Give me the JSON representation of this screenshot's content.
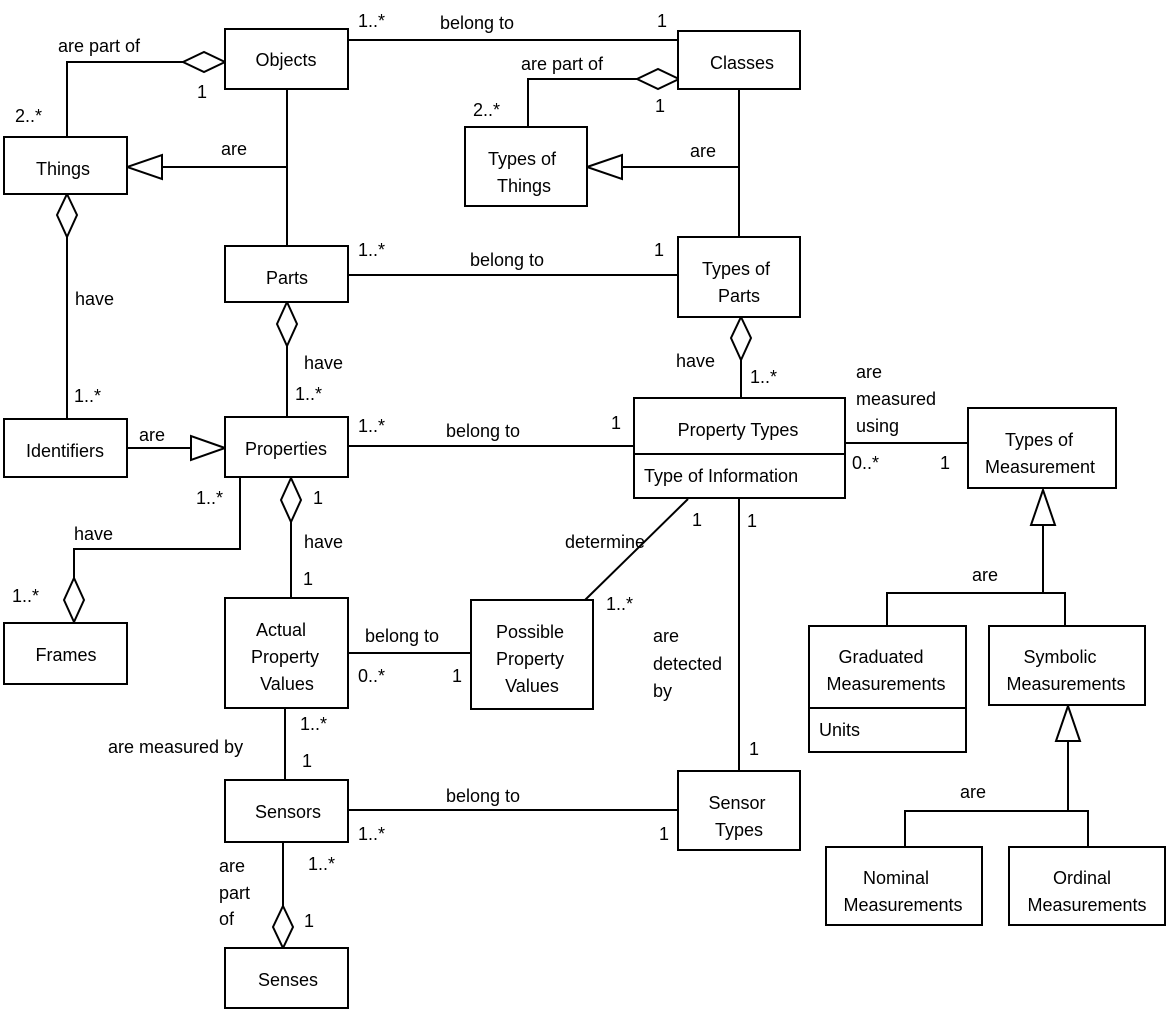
{
  "classes": {
    "objects": [
      "Objects"
    ],
    "classes": [
      "Classes"
    ],
    "things": [
      "Things"
    ],
    "types_of_things": [
      "Types of",
      "Things"
    ],
    "parts": [
      "Parts"
    ],
    "types_of_parts": [
      "Types of",
      "Parts"
    ],
    "identifiers": [
      "Identifiers"
    ],
    "properties": [
      "Properties"
    ],
    "property_types": {
      "name": "Property Types",
      "attribute": "Type of Information"
    },
    "types_of_measurement": [
      "Types of",
      "Measurement"
    ],
    "frames": [
      "Frames"
    ],
    "actual_property_values": [
      "Actual",
      "Property",
      "Values"
    ],
    "possible_property_values": [
      "Possible",
      "Property",
      "Values"
    ],
    "graduated_measurements": {
      "name": [
        "Graduated",
        "Measurements"
      ],
      "attribute": "Units"
    },
    "symbolic_measurements": [
      "Symbolic",
      "Measurements"
    ],
    "sensors": [
      "Sensors"
    ],
    "sensor_types": [
      "Sensor",
      "Types"
    ],
    "nominal_measurements": [
      "Nominal",
      "Measurements"
    ],
    "ordinal_measurements": [
      "Ordinal",
      "Measurements"
    ],
    "senses": [
      "Senses"
    ]
  },
  "labels": [
    "1..*",
    "belong to",
    "1",
    "are part of",
    "1",
    "2..*",
    "are part of",
    "1",
    "2..*",
    "are",
    "are",
    "1..*",
    "belong to",
    "1",
    "have",
    "have",
    "1..*",
    "have",
    "1..*",
    "are",
    "measured",
    "using",
    "1..*",
    "are",
    "1..*",
    "belong to",
    "1",
    "0..*",
    "1",
    "1..*",
    "1",
    "have",
    "have",
    "determine",
    "1",
    "1",
    "1",
    "1..*",
    "1..*",
    "are",
    "belong to",
    "0..*",
    "1",
    "are",
    "detected",
    "by",
    "1..*",
    "are measured by",
    "1",
    "1",
    "belong to",
    "1..*",
    "1",
    "are",
    "are",
    "part",
    "1..*",
    "of",
    "1"
  ]
}
